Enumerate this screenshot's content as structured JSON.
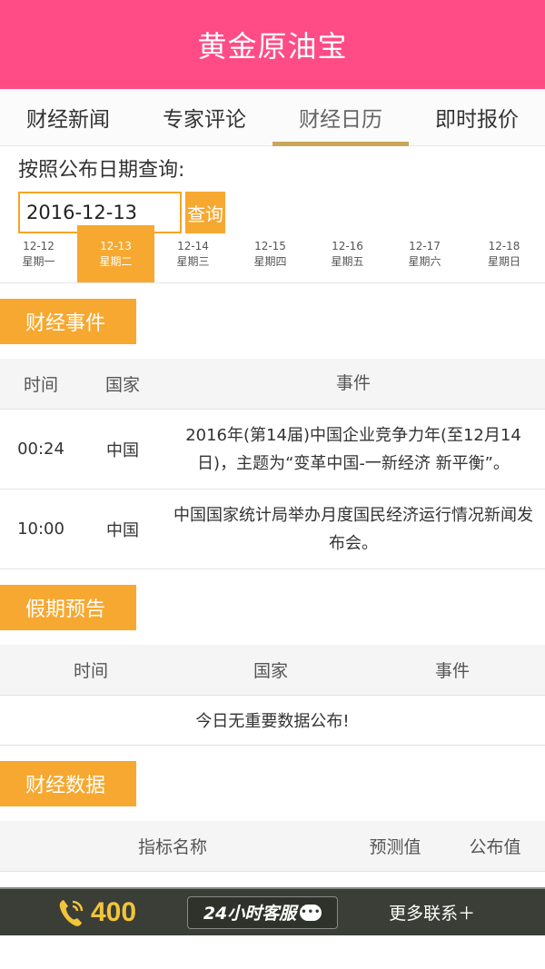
{
  "app": {
    "title": "黄金原油宝"
  },
  "tabs": [
    {
      "label": "财经新闻"
    },
    {
      "label": "专家评论"
    },
    {
      "label": "财经日历",
      "active": true
    },
    {
      "label": "即时报价"
    }
  ],
  "query": {
    "label": "按照公布日期查询:",
    "date_value": "2016-12-13",
    "button_label": "查询"
  },
  "days": [
    {
      "date": "12-12",
      "weekday": "星期一"
    },
    {
      "date": "12-13",
      "weekday": "星期二",
      "active": true
    },
    {
      "date": "12-14",
      "weekday": "星期三"
    },
    {
      "date": "12-15",
      "weekday": "星期四"
    },
    {
      "date": "12-16",
      "weekday": "星期五"
    },
    {
      "date": "12-17",
      "weekday": "星期六"
    },
    {
      "date": "12-18",
      "weekday": "星期日"
    }
  ],
  "events": {
    "title": "财经事件",
    "headers": {
      "time": "时间",
      "country": "国家",
      "event": "事件"
    },
    "rows": [
      {
        "time": "00:24",
        "country": "中国",
        "event": "2016年(第14届)中国企业竞争力年(至12月14日)，主题为“变革中国-一新经济 新平衡”。"
      },
      {
        "time": "10:00",
        "country": "中国",
        "event": "中国国家统计局举办月度国民经济运行情况新闻发布会。"
      }
    ]
  },
  "holidays": {
    "title": "假期预告",
    "headers": {
      "time": "时间",
      "country": "国家",
      "event": "事件"
    },
    "empty_message": "今日无重要数据公布!"
  },
  "data_section": {
    "title": "财经数据",
    "headers": {
      "name": "指标名称",
      "forecast": "预测值",
      "published": "公布值"
    }
  },
  "bottom_bar": {
    "phone_icon": "phone-icon",
    "phone": "400",
    "service_label": "24小时客服",
    "service_bubble": "•••",
    "more_label": "更多联系＋"
  },
  "colors": {
    "header": "#ff4b86",
    "accent": "#f7a830",
    "tab_underline": "#c8a65a",
    "bottom_bar": "#3b3e36",
    "phone_number": "#f3c43a"
  }
}
